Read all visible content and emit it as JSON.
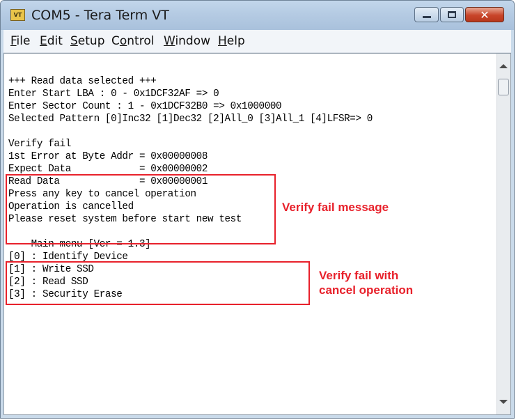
{
  "window": {
    "title": "COM5 - Tera Term VT",
    "app_icon_text": "VT",
    "close_glyph": "✕"
  },
  "menu": {
    "items": [
      {
        "label": "File",
        "hotkey": "F",
        "rest": "ile"
      },
      {
        "label": "Edit",
        "hotkey": "E",
        "rest": "dit"
      },
      {
        "label": "Setup",
        "hotkey": "S",
        "rest": "etup"
      },
      {
        "label": "Control",
        "prefix": "C",
        "hotkey": "o",
        "rest": "ntrol"
      },
      {
        "label": "Window",
        "hotkey": "W",
        "rest": "indow"
      },
      {
        "label": "Help",
        "hotkey": "H",
        "rest": "elp"
      }
    ]
  },
  "terminal": {
    "lines": [
      "+++ Read data selected +++",
      "Enter Start LBA : 0 - 0x1DCF32AF => 0",
      "Enter Sector Count : 1 - 0x1DCF32B0 => 0x1000000",
      "Selected Pattern [0]Inc32 [1]Dec32 [2]All_0 [3]All_1 [4]LFSR=> 0",
      "",
      "Verify fail",
      "1st Error at Byte Addr = 0x00000008",
      "Expect Data            = 0x00000002",
      "Read Data              = 0x00000001",
      "Press any key to cancel operation",
      "Operation is cancelled",
      "Please reset system before start new test",
      "",
      "--- Main menu [Ver = 1.3] ---",
      "[0] : Identify Device",
      "[1] : Write SSD",
      "[2] : Read SSD",
      "[3] : Security Erase"
    ]
  },
  "annotations": {
    "verify_fail_message": "Verify fail message",
    "verify_fail_cancel_line1": "Verify fail with",
    "verify_fail_cancel_line2": "cancel operation",
    "color": "#e8212b"
  }
}
